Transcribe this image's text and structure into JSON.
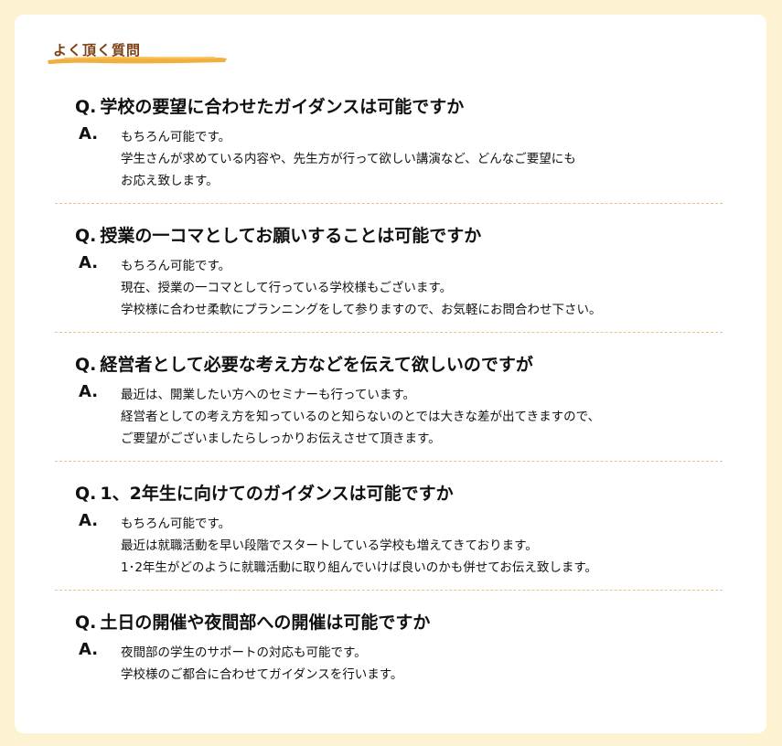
{
  "section": {
    "title": "よく頂く質問",
    "accent_color": "#f0a11f"
  },
  "faq": [
    {
      "q_prefix": "Q.",
      "question": "学校の要望に合わせたガイダンスは可能ですか",
      "a_prefix": "A.",
      "answer": [
        "もちろん可能です。",
        "学生さんが求めている内容や、先生方が行って欲しい講演など、どんなご要望にも",
        "お応え致します。"
      ]
    },
    {
      "q_prefix": "Q.",
      "question": "授業の一コマとしてお願いすることは可能ですか",
      "a_prefix": "A.",
      "answer": [
        "もちろん可能です。",
        "現在、授業の一コマとして行っている学校様もございます。",
        "学校様に合わせ柔軟にプランニングをして参りますので、お気軽にお問合わせ下さい。"
      ]
    },
    {
      "q_prefix": "Q.",
      "question": "経営者として必要な考え方などを伝えて欲しいのですが",
      "a_prefix": "A.",
      "answer": [
        "最近は、開業したい方へのセミナーも行っています。",
        "経営者としての考え方を知っているのと知らないのとでは大きな差が出てきますので、",
        "ご要望がございましたらしっかりお伝えさせて頂きます。"
      ]
    },
    {
      "q_prefix": "Q.",
      "question": "1、2年生に向けてのガイダンスは可能ですか",
      "a_prefix": "A.",
      "answer": [
        "もちろん可能です。",
        "最近は就職活動を早い段階でスタートしている学校も増えてきております。",
        "1･2年生がどのように就職活動に取り組んでいけば良いのかも併せてお伝え致します。"
      ]
    },
    {
      "q_prefix": "Q.",
      "question": "土日の開催や夜間部への開催は可能ですか",
      "a_prefix": "A.",
      "answer": [
        "夜間部の学生のサポートの対応も可能です。",
        "学校様のご都合に合わせてガイダンスを行います。"
      ]
    }
  ]
}
